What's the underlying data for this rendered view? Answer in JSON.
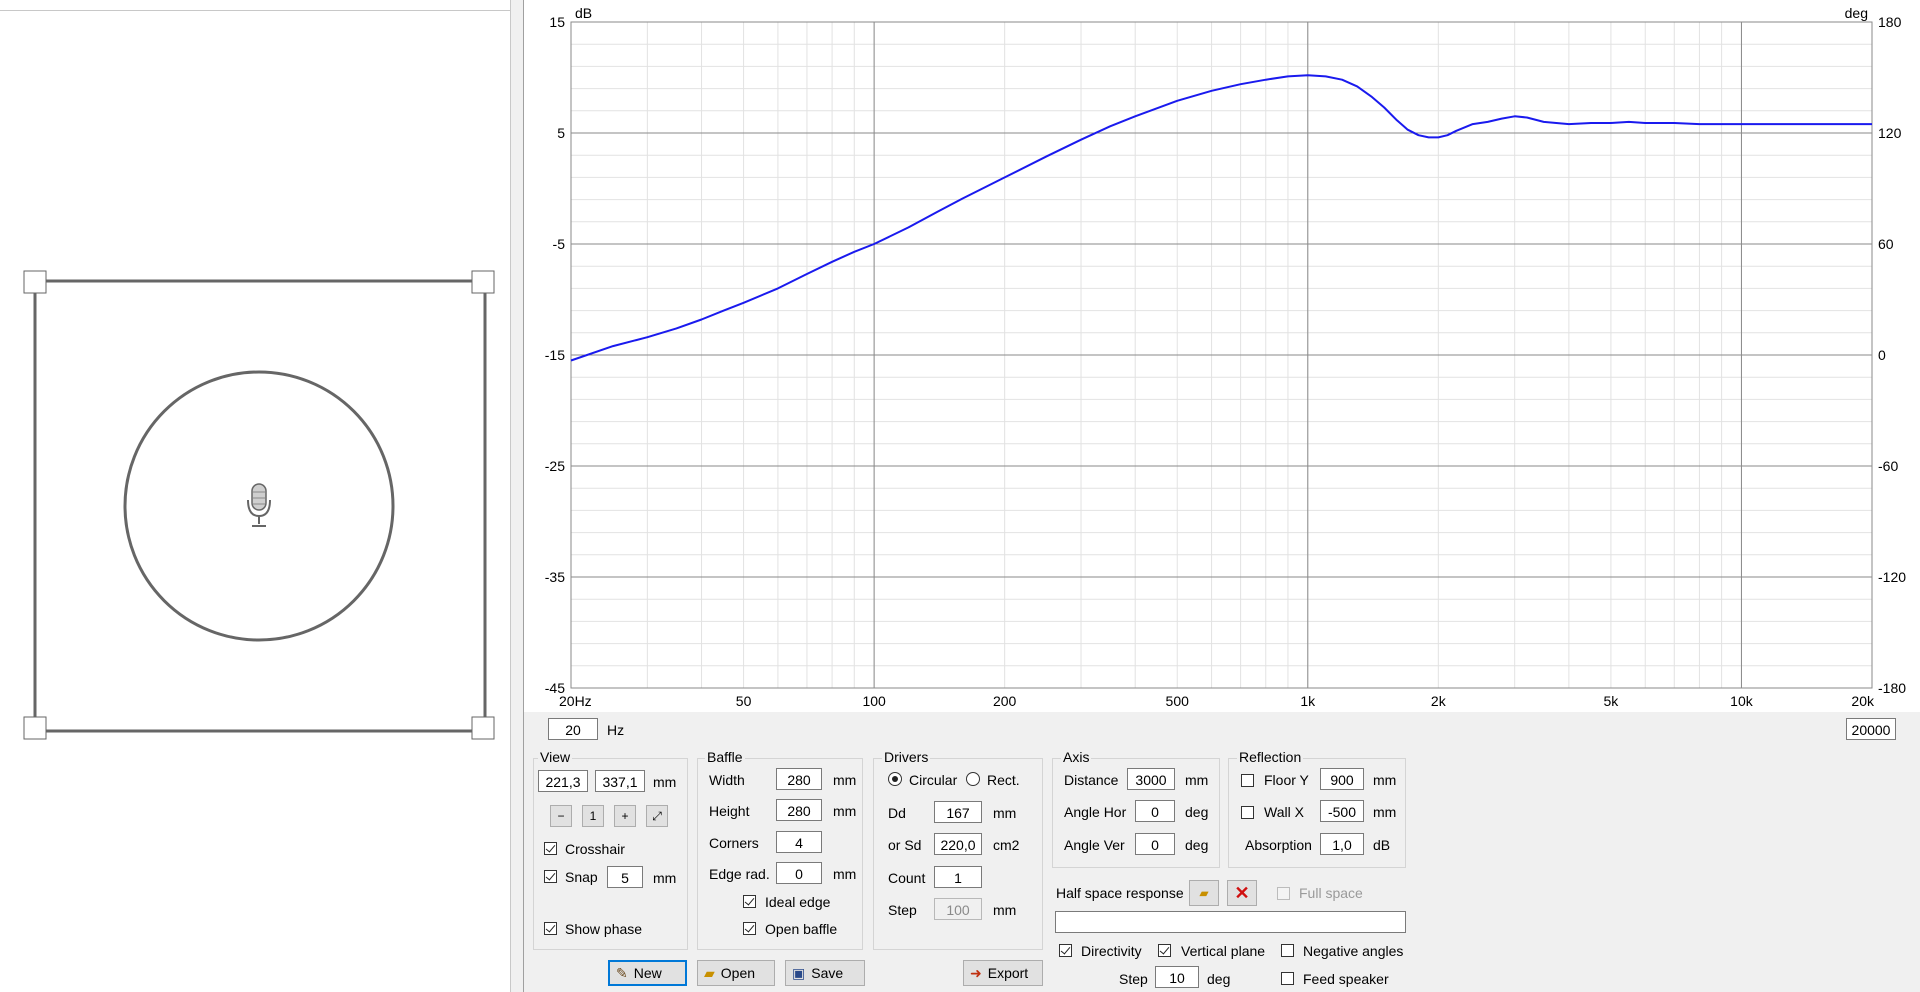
{
  "chart_data": {
    "type": "line",
    "xscale": "log",
    "xlim": [
      20,
      20000
    ],
    "ylim": [
      -45,
      15
    ],
    "y2lim": [
      -180,
      180
    ],
    "ylabel": "dB",
    "y2label": "deg",
    "x_ticks": [
      "20Hz",
      "50",
      "100",
      "200",
      "500",
      "1k",
      "2k",
      "5k",
      "10k",
      "20k"
    ],
    "x_tick_values": [
      20,
      50,
      100,
      200,
      500,
      1000,
      2000,
      5000,
      10000,
      20000
    ],
    "y_ticks": [
      "15",
      "5",
      "-5",
      "-15",
      "-25",
      "-35",
      "-45"
    ],
    "y_tick_values": [
      15,
      5,
      -5,
      -15,
      -25,
      -35,
      -45
    ],
    "y2_ticks": [
      "180",
      "120",
      "60",
      "0",
      "-60",
      "-120",
      "-180"
    ],
    "grid": true,
    "series": [
      {
        "color": "#1a1aee",
        "x": [
          20,
          25,
          30,
          35,
          40,
          45,
          50,
          60,
          70,
          80,
          90,
          100,
          120,
          140,
          160,
          180,
          200,
          250,
          300,
          350,
          400,
          500,
          600,
          700,
          800,
          900,
          1000,
          1100,
          1200,
          1300,
          1400,
          1500,
          1600,
          1700,
          1800,
          1900,
          2000,
          2100,
          2200,
          2400,
          2600,
          2800,
          3000,
          3200,
          3500,
          4000,
          4500,
          5000,
          5500,
          6000,
          7000,
          8000,
          9000,
          10000,
          12000,
          14000,
          16000,
          18000,
          20000
        ],
        "y": [
          -15.5,
          -14.2,
          -13.4,
          -12.6,
          -11.8,
          -11.0,
          -10.3,
          -9.0,
          -7.7,
          -6.6,
          -5.7,
          -5.0,
          -3.5,
          -2.1,
          -0.9,
          0.1,
          1.0,
          2.9,
          4.4,
          5.6,
          6.5,
          7.9,
          8.8,
          9.4,
          9.8,
          10.1,
          10.2,
          10.1,
          9.8,
          9.2,
          8.3,
          7.3,
          6.2,
          5.3,
          4.8,
          4.6,
          4.6,
          4.8,
          5.2,
          5.8,
          6.0,
          6.3,
          6.5,
          6.4,
          6.0,
          5.8,
          5.9,
          5.9,
          6.0,
          5.9,
          5.9,
          5.8,
          5.8,
          5.8,
          5.8,
          5.8,
          5.8,
          5.8,
          5.8
        ]
      }
    ]
  },
  "freq_range": {
    "min": "20",
    "max": "20000",
    "unit": "Hz"
  },
  "view": {
    "title": "View",
    "x": "221,3",
    "y": "337,1",
    "unit": "mm",
    "crosshair_label": "Crosshair",
    "snap_label": "Snap",
    "snap_value": "5",
    "snap_unit": "mm",
    "show_phase_label": "Show phase"
  },
  "baffle": {
    "title": "Baffle",
    "width_label": "Width",
    "width": "280",
    "width_unit": "mm",
    "height_label": "Height",
    "height": "280",
    "height_unit": "mm",
    "corners_label": "Corners",
    "corners": "4",
    "edge_label": "Edge rad.",
    "edge": "0",
    "edge_unit": "mm",
    "ideal_edge_label": "Ideal edge",
    "open_baffle_label": "Open baffle"
  },
  "drivers": {
    "title": "Drivers",
    "circular_label": "Circular",
    "rect_label": "Rect.",
    "dd_label": "Dd",
    "dd": "167",
    "dd_unit": "mm",
    "sd_label": "or Sd",
    "sd": "220,0",
    "sd_unit": "cm2",
    "count_label": "Count",
    "count": "1",
    "step_label": "Step",
    "step": "100",
    "step_unit": "mm"
  },
  "axis": {
    "title": "Axis",
    "distance_label": "Distance",
    "distance": "3000",
    "distance_unit": "mm",
    "angle_hor_label": "Angle Hor",
    "angle_hor": "0",
    "angle_hor_unit": "deg",
    "angle_ver_label": "Angle Ver",
    "angle_ver": "0",
    "angle_ver_unit": "deg"
  },
  "reflection": {
    "title": "Reflection",
    "floor_label": "Floor Y",
    "floor": "900",
    "floor_unit": "mm",
    "wall_label": "Wall  X",
    "wall": "-500",
    "wall_unit": "mm",
    "absorption_label": "Absorption",
    "absorption": "1,0",
    "absorption_unit": "dB"
  },
  "half_space": {
    "label": "Half space response",
    "full_space_label": "Full space",
    "path": ""
  },
  "directivity": {
    "directivity_label": "Directivity",
    "vertical_label": "Vertical plane",
    "negative_label": "Negative angles",
    "feed_label": "Feed speaker",
    "step_label": "Step",
    "step": "10",
    "step_unit": "deg"
  },
  "buttons": {
    "new": "New",
    "open": "Open",
    "save": "Save",
    "export": "Export"
  }
}
